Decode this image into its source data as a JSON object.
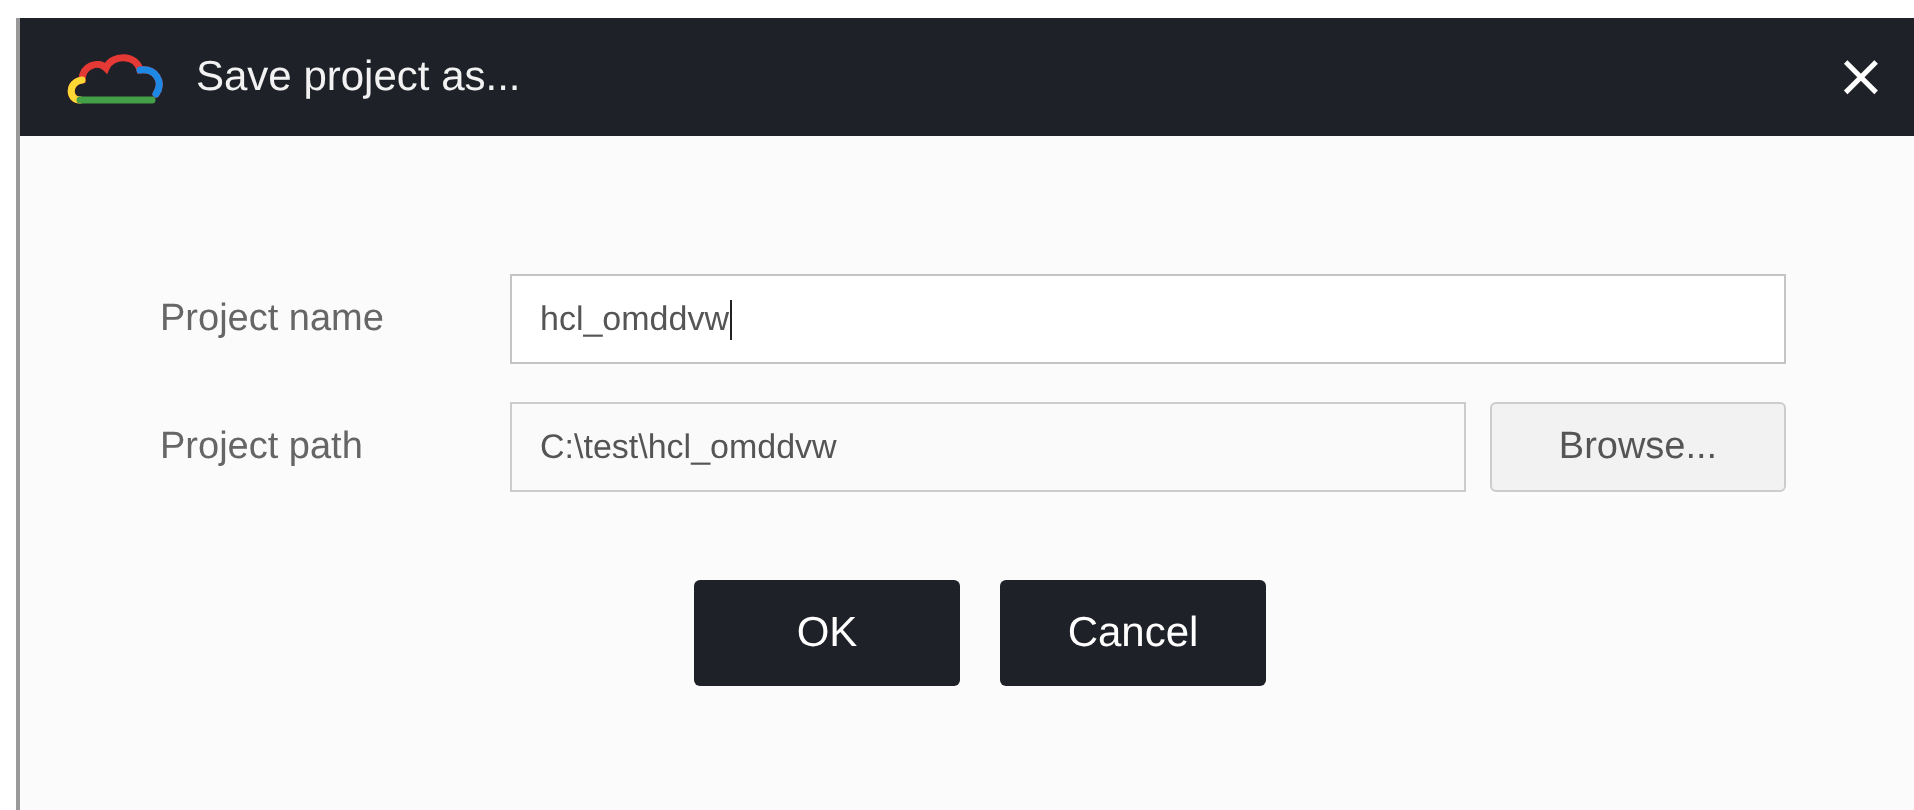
{
  "window": {
    "title": "Save project as...",
    "close": "×"
  },
  "fields": [
    {
      "label": "Project name",
      "value": "hcl_omddvw",
      "focused": true
    },
    {
      "label": "Project path",
      "value": "C:\\test\\hcl_omddvw",
      "focused": false,
      "button": "Browse..."
    }
  ],
  "buttons": [
    "OK",
    "Cancel"
  ]
}
